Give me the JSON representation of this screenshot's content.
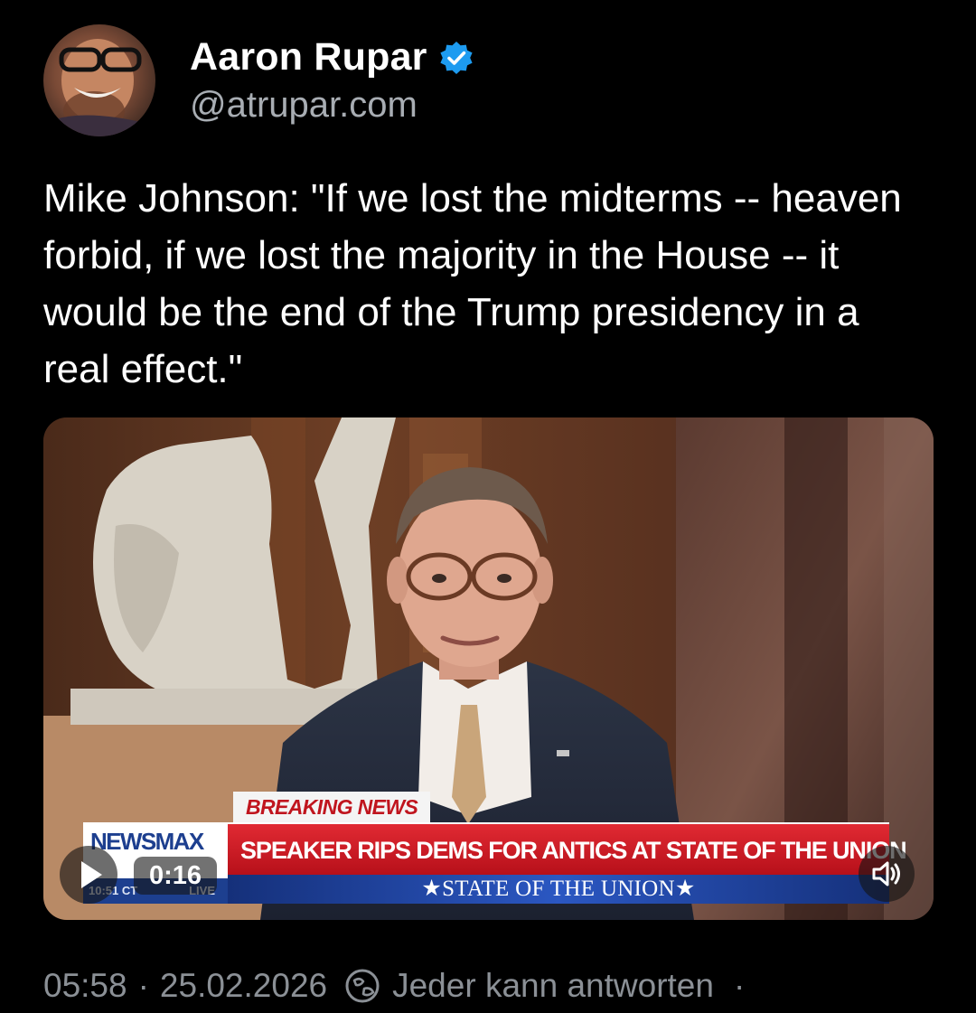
{
  "author": {
    "display_name": "Aaron Rupar",
    "handle": "@atrupar.com",
    "verified_icon": "verified-badge-icon",
    "badge_color": "#1d9bf0"
  },
  "tweet": {
    "text": "Mike Johnson: \"If we lost the midterms -- heaven forbid, if we lost the majority in the House -- it would be the end of the Trump presidency in a real effect.\""
  },
  "video": {
    "duration": "0:16",
    "play_icon": "play-icon",
    "sound_icon": "speaker-icon",
    "chyron": {
      "tag": "BREAKING NEWS",
      "headline": "SPEAKER RIPS DEMS FOR ANTICS AT STATE OF THE UNION",
      "subline": "★STATE OF THE UNION★",
      "network": "NEWSMAX",
      "clock": "10:51 CT",
      "live_label": "LIVE"
    }
  },
  "meta": {
    "time": "05:58",
    "separator": "·",
    "date": "25.02.2026",
    "reply_icon": "reply-audience-icon",
    "reply_setting": "Jeder kann antworten",
    "trailing_dot": "·"
  }
}
